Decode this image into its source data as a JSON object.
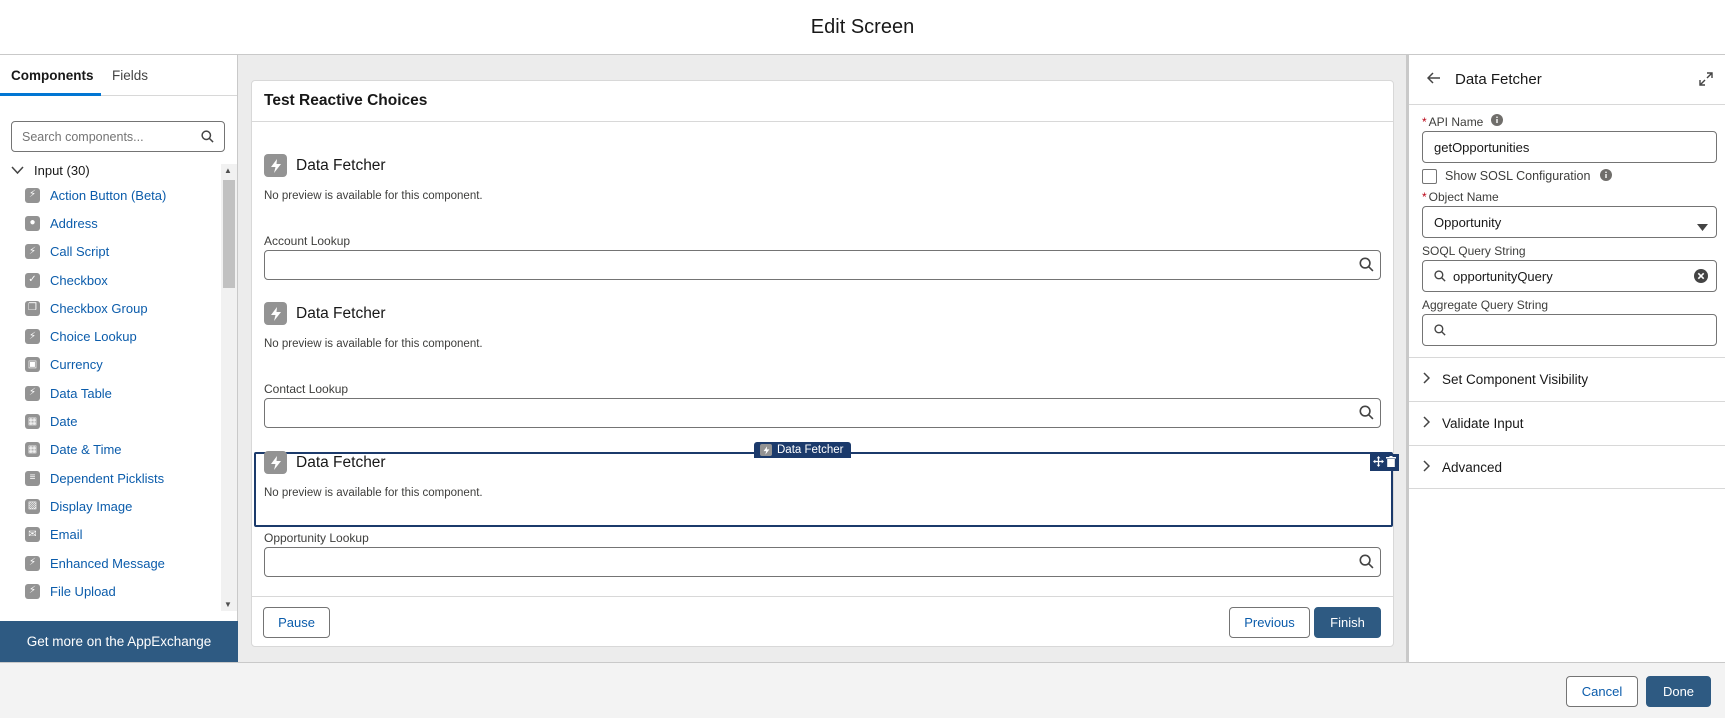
{
  "header": {
    "title": "Edit Screen"
  },
  "left_panel": {
    "tabs": [
      {
        "label": "Components",
        "active": true
      },
      {
        "label": "Fields",
        "active": false
      }
    ],
    "search": {
      "placeholder": "Search components..."
    },
    "group": {
      "label": "Input (30)"
    },
    "items": [
      {
        "label": "Action Button (Beta)",
        "icon": "bolt-icon"
      },
      {
        "label": "Address",
        "icon": "location-pin-icon"
      },
      {
        "label": "Call Script",
        "icon": "bolt-icon"
      },
      {
        "label": "Checkbox",
        "icon": "checkmark-icon"
      },
      {
        "label": "Checkbox Group",
        "icon": "checkbox-group-icon"
      },
      {
        "label": "Choice Lookup",
        "icon": "bolt-icon"
      },
      {
        "label": "Currency",
        "icon": "currency-icon"
      },
      {
        "label": "Data Table",
        "icon": "bolt-icon"
      },
      {
        "label": "Date",
        "icon": "calendar-icon"
      },
      {
        "label": "Date & Time",
        "icon": "calendar-clock-icon"
      },
      {
        "label": "Dependent Picklists",
        "icon": "list-icon"
      },
      {
        "label": "Display Image",
        "icon": "image-icon"
      },
      {
        "label": "Email",
        "icon": "envelope-icon"
      },
      {
        "label": "Enhanced Message",
        "icon": "bolt-icon"
      },
      {
        "label": "File Upload",
        "icon": "bolt-icon"
      }
    ],
    "appexchange_label": "Get more on the AppExchange"
  },
  "canvas": {
    "screen_title": "Test Reactive Choices",
    "blocks": [
      {
        "title": "Data Fetcher",
        "note": "No preview is available for this component."
      },
      {
        "title": "Data Fetcher",
        "note": "No preview is available for this component."
      },
      {
        "title": "Data Fetcher",
        "note": "No preview is available for this component."
      }
    ],
    "lookups": [
      {
        "label": "Account Lookup"
      },
      {
        "label": "Contact Lookup"
      },
      {
        "label": "Opportunity Lookup"
      }
    ],
    "selected_tag": "Data Fetcher",
    "footer": {
      "pause": "Pause",
      "previous": "Previous",
      "finish": "Finish"
    }
  },
  "right_panel": {
    "title": "Data Fetcher",
    "api_name": {
      "label": "API Name",
      "value": "getOpportunities"
    },
    "sosl_checkbox": {
      "label": "Show SOSL Configuration",
      "checked": false
    },
    "object_name": {
      "label": "Object Name",
      "value": "Opportunity"
    },
    "soql": {
      "label": "SOQL Query String",
      "value": "opportunityQuery"
    },
    "aggregate": {
      "label": "Aggregate Query String",
      "value": ""
    },
    "sections": [
      {
        "label": "Set Component Visibility"
      },
      {
        "label": "Validate Input"
      },
      {
        "label": "Advanced"
      }
    ]
  },
  "bottom_bar": {
    "cancel": "Cancel",
    "done": "Done"
  },
  "colors": {
    "brand": "#2e5a82",
    "link": "#0b5cab",
    "selection": "#1b3a6b",
    "tab_accent": "#0176d3"
  }
}
